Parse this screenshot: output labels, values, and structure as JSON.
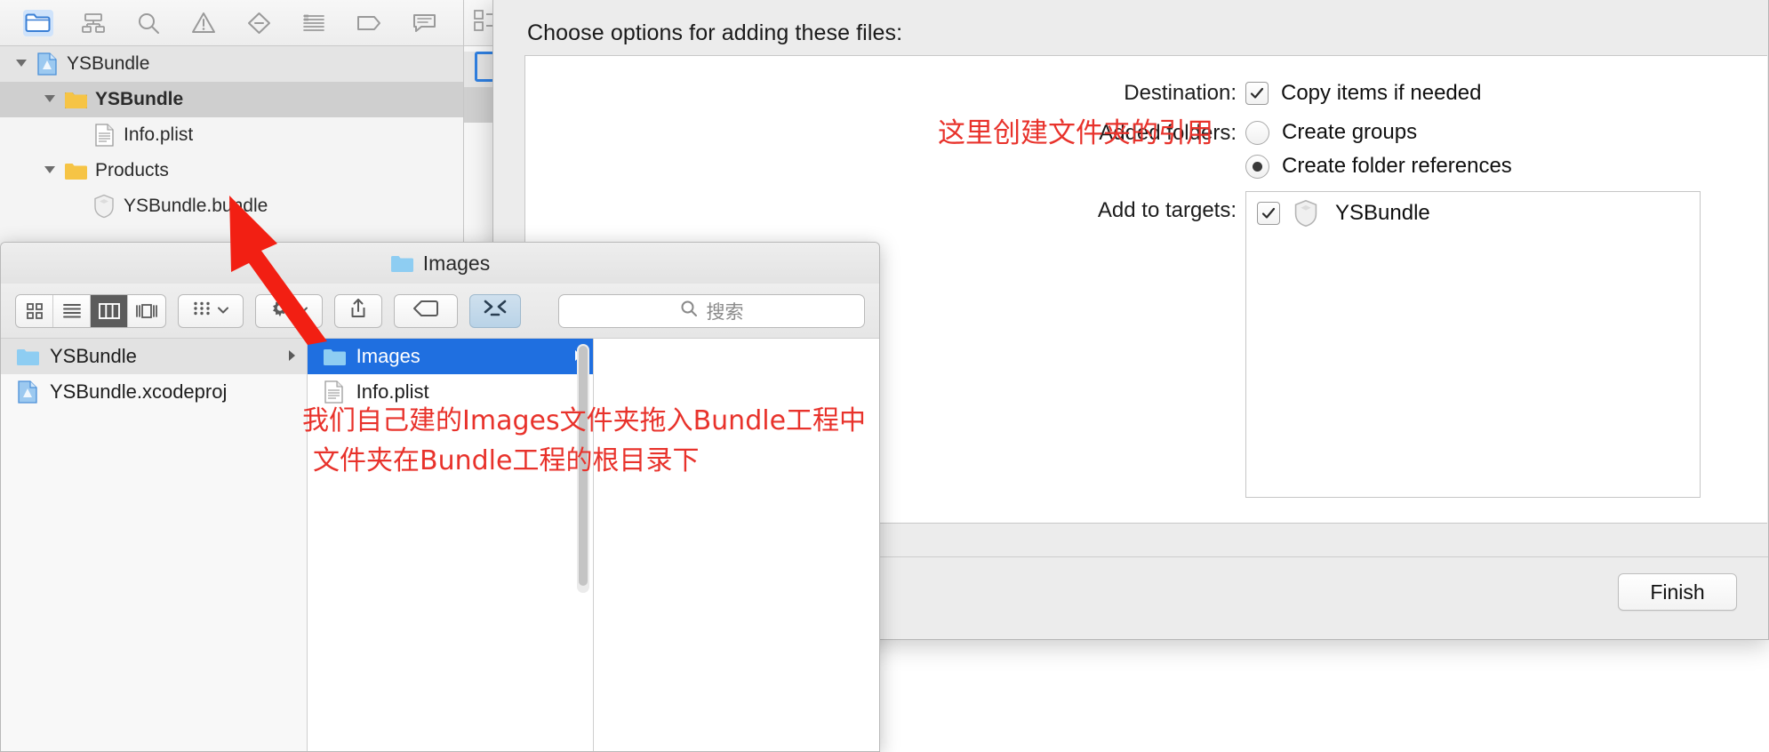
{
  "xcode_navigator": {
    "toolbar_icons": [
      {
        "name": "folder-icon",
        "active": true
      },
      {
        "name": "hierarchy-icon",
        "active": false
      },
      {
        "name": "search-icon",
        "active": false
      },
      {
        "name": "warning-icon",
        "active": false
      },
      {
        "name": "breakpoint-icon",
        "active": false
      },
      {
        "name": "report-icon",
        "active": false
      },
      {
        "name": "tag-icon",
        "active": false
      },
      {
        "name": "comment-icon",
        "active": false
      }
    ],
    "tree": [
      {
        "label": "YSBundle",
        "icon": "xcode-project-icon",
        "indent": 0,
        "expanded": true,
        "state": "sel-light",
        "bold": false
      },
      {
        "label": "YSBundle",
        "icon": "folder-yellow-icon",
        "indent": 1,
        "expanded": true,
        "state": "sel-dark",
        "bold": true
      },
      {
        "label": "Info.plist",
        "icon": "plist-file-icon",
        "indent": 2,
        "expanded": null,
        "state": "",
        "bold": false
      },
      {
        "label": "Products",
        "icon": "folder-yellow-icon",
        "indent": 1,
        "expanded": true,
        "state": "",
        "bold": false
      },
      {
        "label": "YSBundle.bundle",
        "icon": "bundle-icon",
        "indent": 2,
        "expanded": null,
        "state": "",
        "bold": false
      }
    ]
  },
  "sheet": {
    "title": "Choose options for adding these files:",
    "destination": {
      "label": "Destination:",
      "checkbox_label": "Copy items if needed",
      "checked": true
    },
    "added_folders": {
      "label": "Added folders:",
      "options": [
        {
          "label": "Create groups",
          "selected": false
        },
        {
          "label": "Create folder references",
          "selected": true
        }
      ]
    },
    "add_to_targets": {
      "label": "Add to targets:",
      "rows": [
        {
          "name": "YSBundle",
          "checked": true,
          "icon": "bundle-icon"
        }
      ]
    },
    "finish_button": "Finish"
  },
  "annotations": {
    "top_right": "这里创建文件夹的引用",
    "bottom_line1": "我们自己建的Images文件夹拖入Bundle工程中",
    "bottom_line2": "文件夹在Bundle工程的根目录下",
    "color": "#e8322b"
  },
  "finder": {
    "title": "Images",
    "title_icon": "folder-blue-icon",
    "view_modes": [
      {
        "name": "icon-view-icon",
        "active": false
      },
      {
        "name": "list-view-icon",
        "active": false
      },
      {
        "name": "column-view-icon",
        "active": true
      },
      {
        "name": "gallery-view-icon",
        "active": false
      }
    ],
    "toolbar_buttons": [
      {
        "name": "arrange-button",
        "icon": "grid-dots-icon",
        "has_chevron": true
      },
      {
        "name": "action-button",
        "icon": "gear-icon",
        "has_chevron": true
      },
      {
        "name": "share-button",
        "icon": "share-icon",
        "has_chevron": false
      },
      {
        "name": "tags-button",
        "icon": "tag-icon",
        "has_chevron": false
      },
      {
        "name": "terminal-button",
        "icon": "terminal-icon",
        "has_chevron": false
      }
    ],
    "search_placeholder": "搜索",
    "columns": [
      {
        "items": [
          {
            "label": "YSBundle",
            "icon": "folder-blue-icon",
            "state": "sel-gray",
            "chevron": true
          },
          {
            "label": "YSBundle.xcodeproj",
            "icon": "xcode-project-icon",
            "state": "",
            "chevron": false
          }
        ]
      },
      {
        "items": [
          {
            "label": "Images",
            "icon": "folder-blue-icon",
            "state": "sel-blue",
            "chevron": true
          },
          {
            "label": "Info.plist",
            "icon": "plist-file-icon",
            "state": "",
            "chevron": false
          }
        ]
      },
      {
        "items": []
      }
    ]
  }
}
